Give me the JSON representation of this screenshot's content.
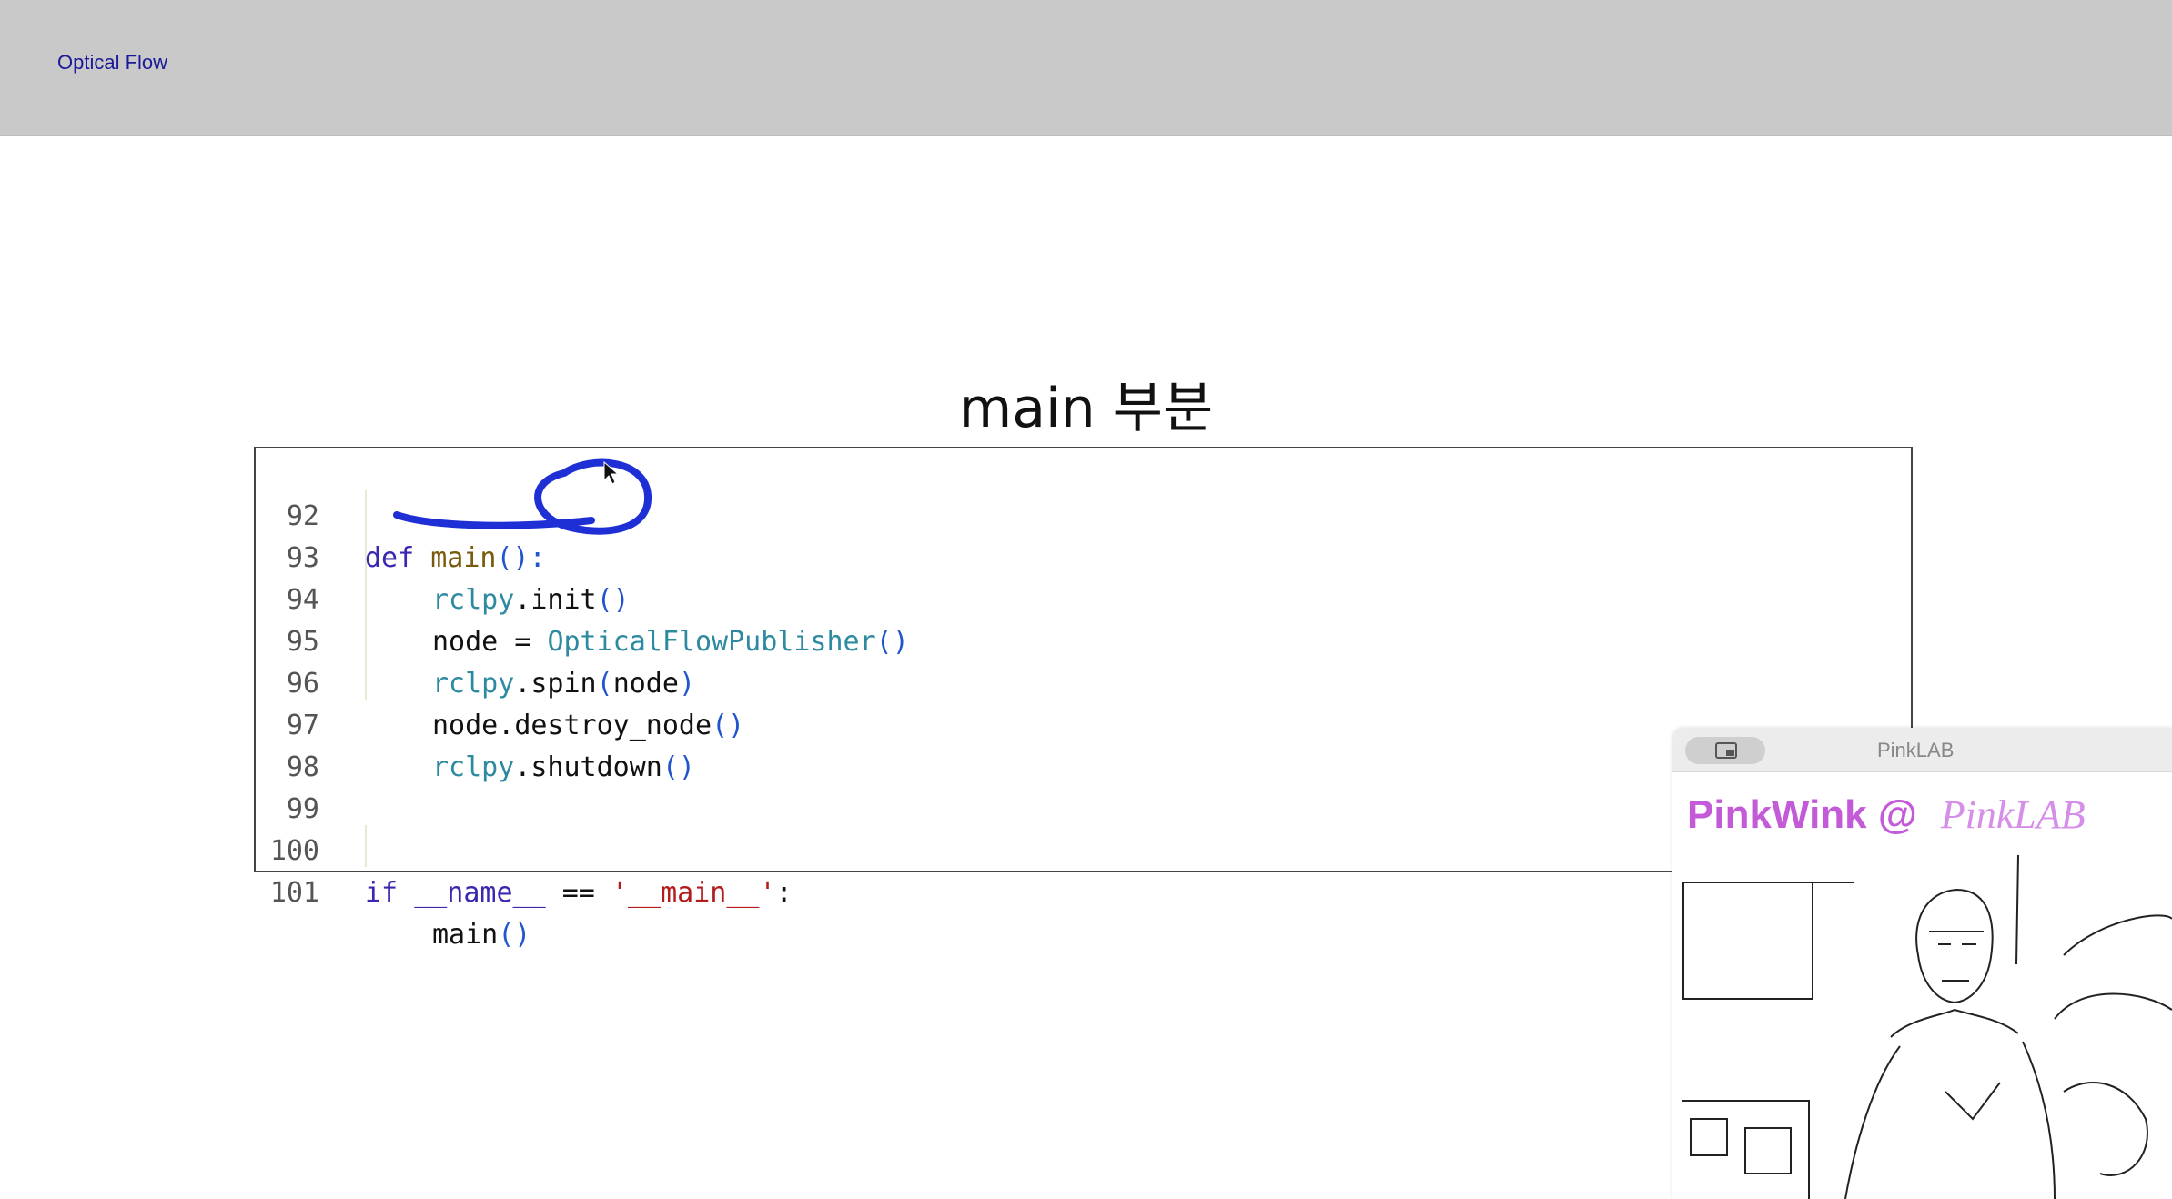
{
  "header": {
    "title": "Optical Flow"
  },
  "slide": {
    "title": "main 부분"
  },
  "code": {
    "lines": [
      {
        "num": "92"
      },
      {
        "num": "93"
      },
      {
        "num": "94"
      },
      {
        "num": "95"
      },
      {
        "num": "96"
      },
      {
        "num": "97"
      },
      {
        "num": "98"
      },
      {
        "num": "99"
      },
      {
        "num": "100"
      },
      {
        "num": "101"
      }
    ],
    "tokens": {
      "def": "def",
      "main": "main",
      "paren_colon": "():",
      "rclpy": "rclpy",
      "dot": ".",
      "init": "init",
      "parens": "()",
      "node": "node",
      "eq": " = ",
      "publisher": "OpticalFlowPublisher",
      "spin": "spin",
      "open": "(",
      "close": ")",
      "destroy": "destroy_node",
      "shutdown": "shutdown",
      "if": "if",
      "dunder_name": "__name__",
      "eqeq": " == ",
      "main_str": "'__main__'",
      "colon": ":"
    }
  },
  "annotation": {
    "color": "#1f2fd6"
  },
  "pip": {
    "window_title": "PinkLAB",
    "banner_left": "PinkWink @",
    "banner_right": "PinkLAB",
    "icon": "picture-in-picture-icon"
  }
}
